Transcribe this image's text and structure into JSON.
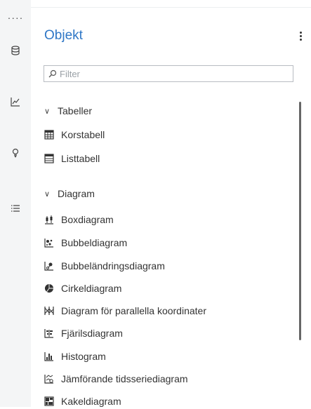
{
  "rail": {
    "items": [
      {
        "name": "database-icon"
      },
      {
        "name": "line-chart-icon"
      },
      {
        "name": "lightbulb-icon"
      },
      {
        "name": "list-icon"
      }
    ]
  },
  "panel": {
    "title": "Objekt",
    "filter_placeholder": "Filter"
  },
  "groups": [
    {
      "label": "Tabeller",
      "items": [
        {
          "label": "Korstabell",
          "icon": "crosstab-icon"
        },
        {
          "label": "Listtabell",
          "icon": "list-table-icon"
        }
      ]
    },
    {
      "label": "Diagram",
      "items": [
        {
          "label": "Boxdiagram",
          "icon": "box-plot-icon"
        },
        {
          "label": "Bubbeldiagram",
          "icon": "bubble-chart-icon"
        },
        {
          "label": "Bubbeländringsdiagram",
          "icon": "bubble-change-icon"
        },
        {
          "label": "Cirkeldiagram",
          "icon": "pie-chart-icon"
        },
        {
          "label": "Diagram för parallella koordinater",
          "icon": "parallel-coordinates-icon"
        },
        {
          "label": "Fjärilsdiagram",
          "icon": "butterfly-chart-icon"
        },
        {
          "label": "Histogram",
          "icon": "histogram-icon"
        },
        {
          "label": "Jämförande tidsseriediagram",
          "icon": "time-series-compare-icon"
        },
        {
          "label": "Kakeldiagram",
          "icon": "tile-chart-icon"
        }
      ]
    }
  ]
}
